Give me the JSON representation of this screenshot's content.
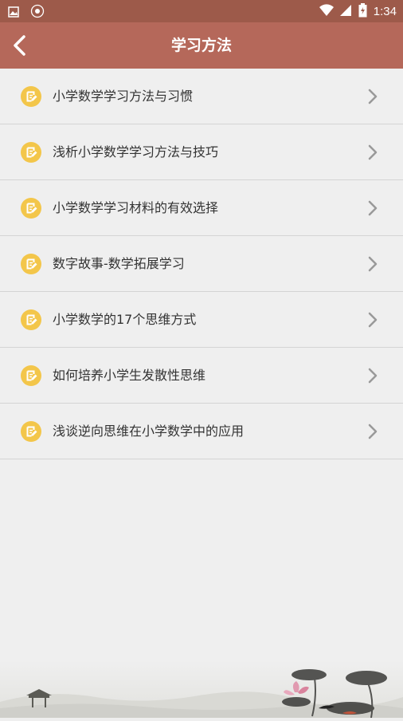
{
  "status_bar": {
    "time": "1:34",
    "icons": [
      "image-icon",
      "badge-icon",
      "wifi-icon",
      "signal-icon",
      "battery-icon"
    ]
  },
  "header": {
    "title": "学习方法",
    "back_icon": "back-arrow-icon"
  },
  "list": {
    "items": [
      {
        "label": "小学数学学习方法与习惯"
      },
      {
        "label": "浅析小学数学学习方法与技巧"
      },
      {
        "label": "小学数学学习材料的有效选择"
      },
      {
        "label": "数字故事-数学拓展学习"
      },
      {
        "label": "小学数学的17个思维方式"
      },
      {
        "label": "如何培养小学生发散性思维"
      },
      {
        "label": "浅谈逆向思维在小学数学中的应用"
      }
    ],
    "item_icon": "note-icon",
    "chevron_icon": "chevron-right-icon"
  },
  "colors": {
    "status_bar": "#9d5a4a",
    "app_bar": "#b5685a",
    "background": "#efefef",
    "icon_yellow": "#f3c64a"
  }
}
